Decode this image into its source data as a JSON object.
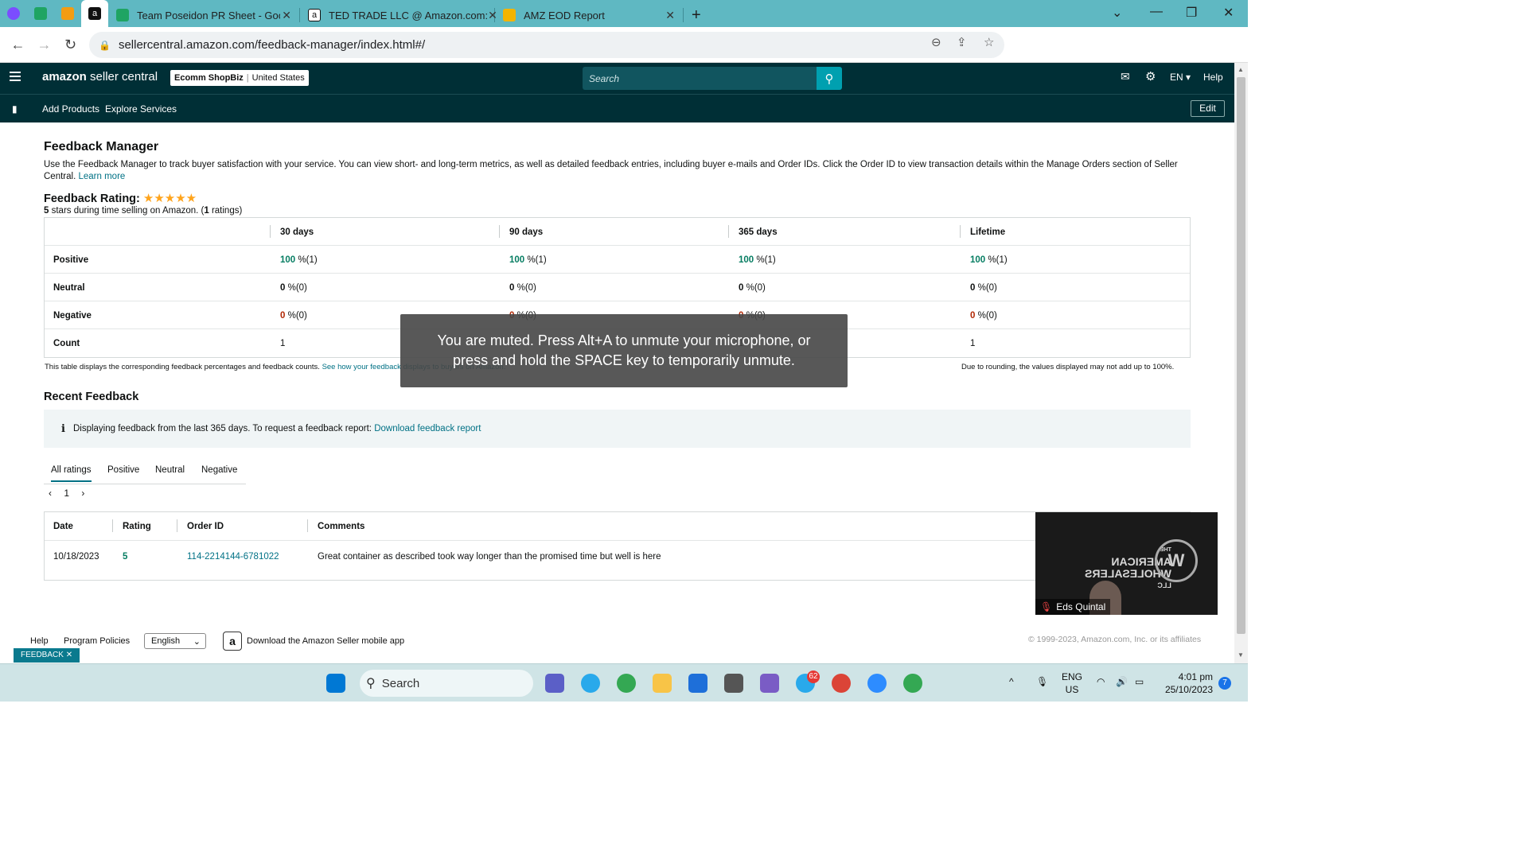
{
  "browser": {
    "tabs": [
      {
        "title": "Team Poseidon PR Sheet - Goog",
        "color": "#1fa463"
      },
      {
        "title": "TED TRADE LLC @ Amazon.com:",
        "color": "#111111"
      },
      {
        "title": "AMZ EOD Report",
        "color": "#f4b400"
      }
    ],
    "url": "sellercentral.amazon.com/feedback-manager/index.html#/"
  },
  "header": {
    "logo_main": "amazon",
    "logo_sub": "seller central",
    "store_name": "Ecomm ShopBiz",
    "store_country": "United States",
    "search_placeholder": "Search",
    "lang": "EN",
    "help": "Help"
  },
  "subnav": {
    "items": [
      "Add Products",
      "Explore Services"
    ],
    "edit": "Edit"
  },
  "page": {
    "title": "Feedback Manager",
    "description": "Use the Feedback Manager to track buyer satisfaction with your service. You can view short- and long-term metrics, as well as detailed feedback entries, including buyer e-mails and Order IDs. Click the Order ID to view transaction details within the Manage Orders section of Seller Central.",
    "learn_more": "Learn more",
    "rating_title": "Feedback Rating:",
    "stars": "★★★★★",
    "rating_stars": "5",
    "rating_sub_mid": " stars during time selling on Amazon. (",
    "rating_count": "1",
    "rating_sub_end": " ratings)"
  },
  "feedback_table": {
    "columns": [
      "30 days",
      "90 days",
      "365 days",
      "Lifetime"
    ],
    "rows": [
      {
        "label": "Positive",
        "values": [
          [
            "100",
            " %(1)"
          ],
          [
            "100",
            " %(1)"
          ],
          [
            "100",
            " %(1)"
          ],
          [
            "100",
            " %(1)"
          ]
        ]
      },
      {
        "label": "Neutral",
        "values": [
          [
            "0",
            " %(0)"
          ],
          [
            "0",
            " %(0)"
          ],
          [
            "0",
            " %(0)"
          ],
          [
            "0",
            " %(0)"
          ]
        ]
      },
      {
        "label": "Negative",
        "values": [
          [
            "0",
            " %(0)"
          ],
          [
            "0",
            " %(0)"
          ],
          [
            "0",
            " %(0)"
          ],
          [
            "0",
            " %(0)"
          ]
        ]
      },
      {
        "label": "Count",
        "values": [
          "1",
          "1",
          "1",
          "1"
        ]
      }
    ],
    "note": "This table displays the corresponding feedback percentages and feedback counts.",
    "note_link": "See how your feedback displays to buyers on Amazon.",
    "rounding_note": "Due to rounding, the values displayed may not add up to 100%."
  },
  "recent": {
    "title": "Recent Feedback",
    "info": "Displaying feedback from the last 365 days. To request a feedback report:",
    "info_link": "Download feedback report",
    "tabs": [
      "All ratings",
      "Positive",
      "Neutral",
      "Negative"
    ],
    "page": "1",
    "columns": [
      "Date",
      "Rating",
      "Order ID",
      "Comments"
    ],
    "row": {
      "date": "10/18/2023",
      "rating": "5",
      "order_id": "114-2214144-6781022",
      "comment": "Great container as described took way longer than the promised time but well is here"
    }
  },
  "overlay": {
    "line1": "You are muted. Press Alt+A to unmute your microphone, or",
    "line2": "press and hold the SPACE key to temporarily unmute."
  },
  "video": {
    "name": "Eds Quintal",
    "brand_line1": "THE",
    "brand_line2": "AMERICAN",
    "brand_line3": "WHOLESALERS",
    "brand_line4": "LLC",
    "emblem": "W"
  },
  "footer": {
    "help": "Help",
    "policies": "Program Policies",
    "language": "English",
    "app_text": "Download the Amazon Seller mobile app",
    "copyright": "© 1999-2023, Amazon.com, Inc. or its affiliates",
    "feedback": "FEEDBACK"
  },
  "taskbar": {
    "search": "Search",
    "lang1": "ENG",
    "lang2": "US",
    "time": "4:01 pm",
    "date": "25/10/2023",
    "notif_count": "7",
    "telegram_badge": "62"
  }
}
